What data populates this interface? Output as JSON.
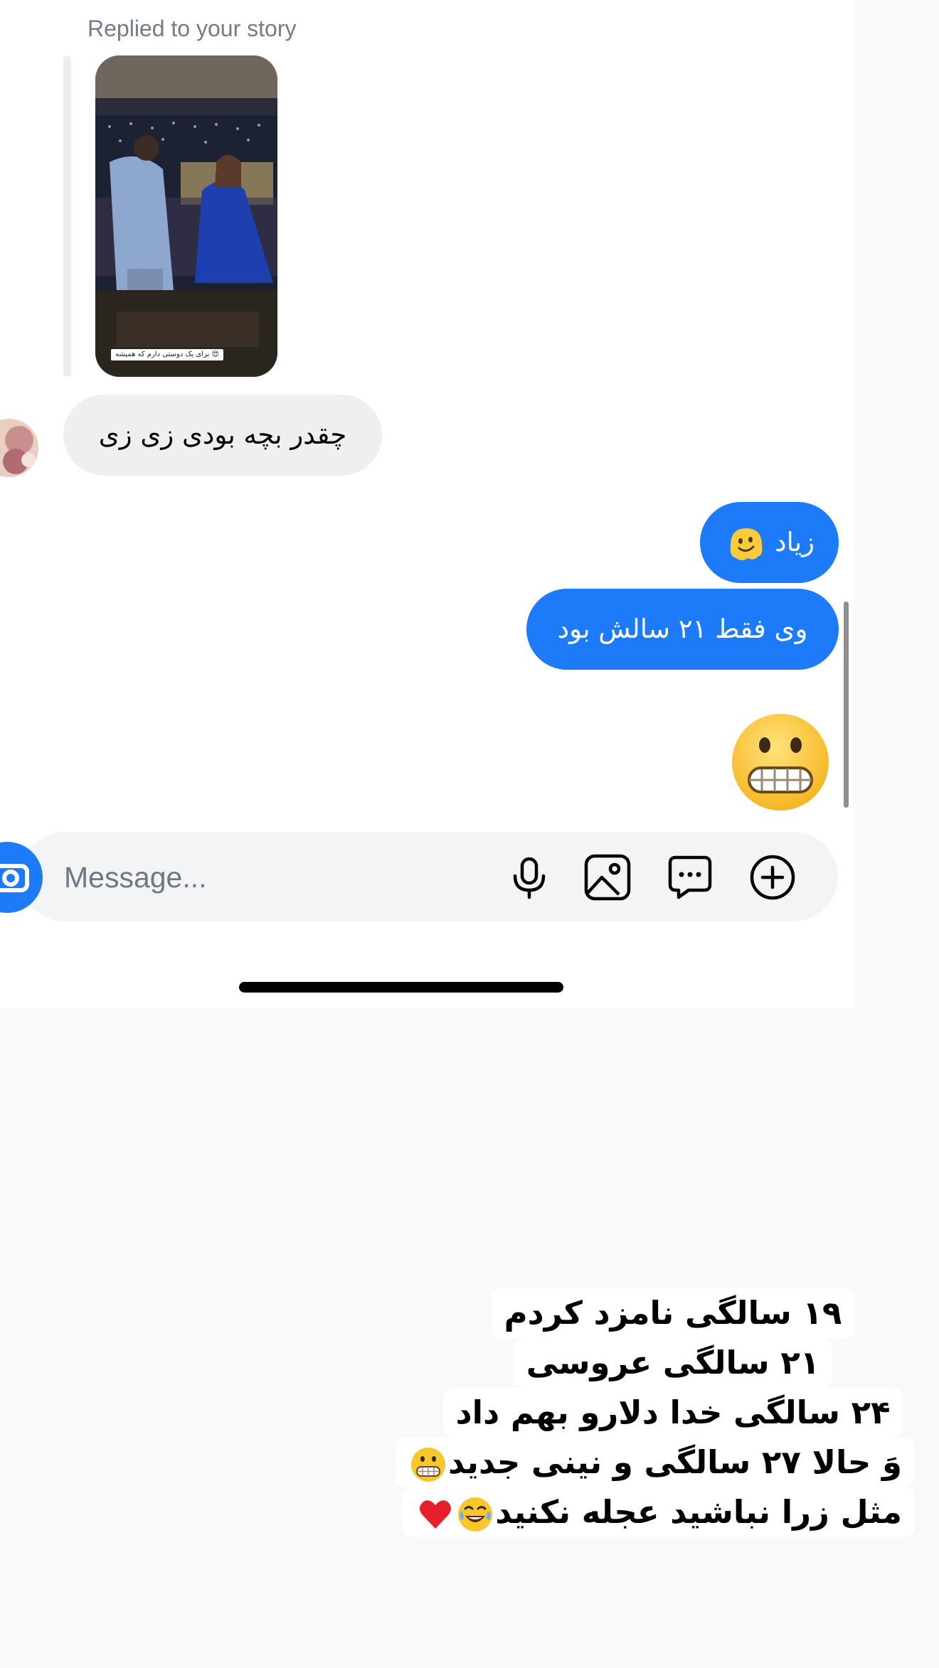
{
  "chat": {
    "reply_label": "Replied to your story",
    "story_caption": "برای یک دوستی دارم که همیشه 😍",
    "incoming_message": "چقدر بچه بودی زی زی",
    "outgoing_messages": [
      {
        "text": "زیاد",
        "emoji": "melting-face-emoji"
      },
      {
        "text": "وی فقط ۲۱ سالش بود"
      }
    ],
    "big_emoji": "grimacing-face-emoji"
  },
  "composer": {
    "placeholder": "Message...",
    "icons": [
      "camera-icon",
      "microphone-icon",
      "image-icon",
      "sticker-chat-icon",
      "plus-circle-icon"
    ]
  },
  "story_caption_overlay": {
    "lines": [
      "۱۹ سالگی نامزد کردم",
      "۲۱ سالگی عروسی",
      "۲۴ سالگی خدا دلارو بهم داد",
      "وَ حالا ۲۷ سالگی و نینی جدید",
      "مثل زرا نباشید عجله نکنید"
    ],
    "emojis": [
      "grimacing-face-emoji",
      "tears-of-joy-emoji",
      "red-heart-emoji"
    ]
  },
  "colors": {
    "accent": "#1d7bfa",
    "incoming_bubble": "#efefef",
    "composer_bg": "#f3f4f5",
    "page_bg": "#f9f9f9"
  }
}
